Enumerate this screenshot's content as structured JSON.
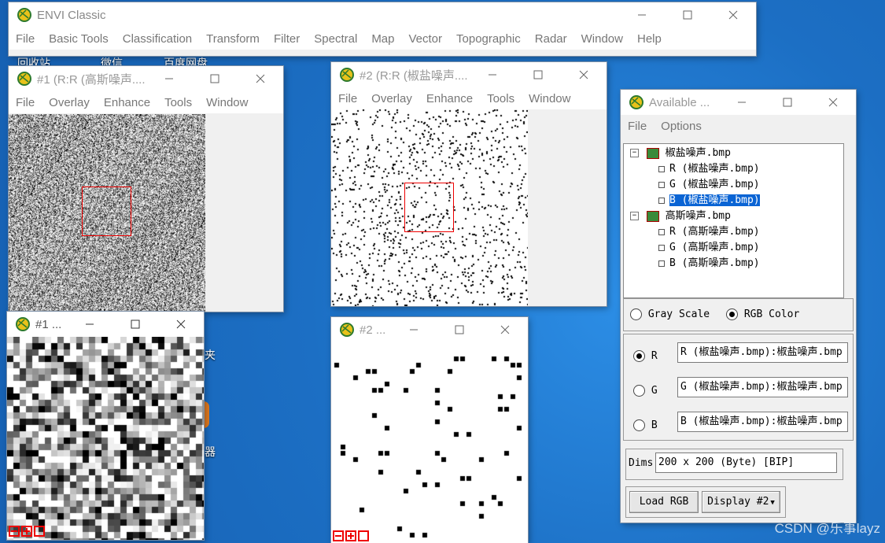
{
  "desktop": {
    "icons": [
      "回收站",
      "微信",
      "百度网盘",
      "夹",
      "器"
    ]
  },
  "envi_main": {
    "title": "ENVI Classic",
    "menu": [
      "File",
      "Basic Tools",
      "Classification",
      "Transform",
      "Filter",
      "Spectral",
      "Map",
      "Vector",
      "Topographic",
      "Radar",
      "Window",
      "Help"
    ]
  },
  "win1": {
    "title": "#1 (R:R (高斯噪声....",
    "menu": [
      "File",
      "Overlay",
      "Enhance",
      "Tools",
      "Window"
    ]
  },
  "win2": {
    "title": "#2 (R:R (椒盐噪声....",
    "menu": [
      "File",
      "Overlay",
      "Enhance",
      "Tools",
      "Window"
    ]
  },
  "zoom1": {
    "title": "#1 ..."
  },
  "zoom2": {
    "title": "#2 ..."
  },
  "avail": {
    "title": "Available ...",
    "menu": [
      "File",
      "Options"
    ],
    "tree": {
      "file1": "椒盐噪声.bmp",
      "file1_bands": [
        "R (椒盐噪声.bmp)",
        "G (椒盐噪声.bmp)",
        "B (椒盐噪声.bmp)"
      ],
      "file2": "高斯噪声.bmp",
      "file2_bands": [
        "R (高斯噪声.bmp)",
        "G (高斯噪声.bmp)",
        "B (高斯噪声.bmp)"
      ],
      "selected": "B (椒盐噪声.bmp)"
    },
    "mode": {
      "gray": "Gray Scale",
      "rgb": "RGB Color",
      "selected": "RGB Color"
    },
    "channels": [
      {
        "label": "R",
        "value": "R (椒盐噪声.bmp):椒盐噪声.bmp"
      },
      {
        "label": "G",
        "value": "G (椒盐噪声.bmp):椒盐噪声.bmp"
      },
      {
        "label": "B",
        "value": "B (椒盐噪声.bmp):椒盐噪声.bmp"
      }
    ],
    "dims_label": "Dims",
    "dims_value": "200 x 200 (Byte) [BIP]",
    "load_button": "Load RGB",
    "display_button": "Display #2"
  },
  "watermark": "CSDN @乐事layz",
  "colors": {
    "roi": "#e00000",
    "selection": "#0a64d4"
  }
}
